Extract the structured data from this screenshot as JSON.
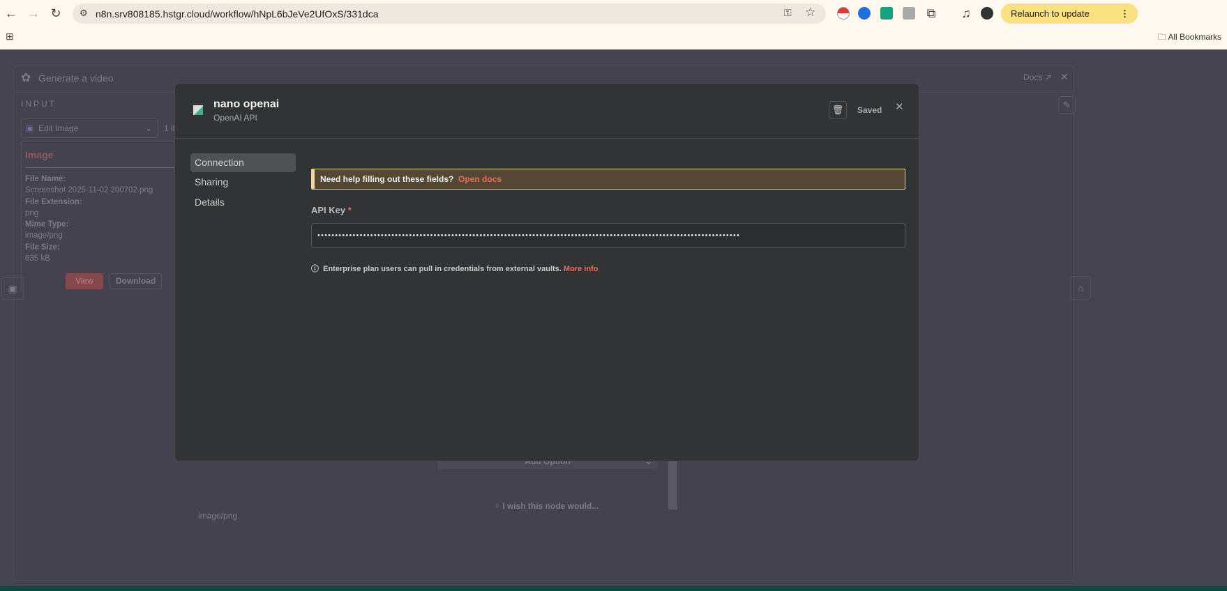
{
  "browser": {
    "url": "n8n.srv808185.hstgr.cloud/workflow/hNpL6bJeVe2UfOxS/331dca",
    "relaunch_label": "Relaunch to update",
    "bookmarks_label": "All Bookmarks"
  },
  "node_panel": {
    "title": "Generate a video",
    "docs_label": "Docs",
    "input_label": "INPUT",
    "dropdown_value": "Edit Image",
    "items_count": "1 it",
    "binary": {
      "title": "Image",
      "fields": [
        {
          "label": "File Name:",
          "value": "Screenshot 2025-11-02 200702.png"
        },
        {
          "label": "File Extension:",
          "value": "png"
        },
        {
          "label": "Mime Type:",
          "value": "image/png"
        },
        {
          "label": "File Size:",
          "value": "635 kB"
        }
      ],
      "view_label": "View",
      "download_label": "Download"
    },
    "add_option_label": "Add Option",
    "feedback_label": "I wish this node would...",
    "bottom_mime": "image/png"
  },
  "modal": {
    "title": "nano openai",
    "subtitle": "OpenAI API",
    "saved_label": "Saved",
    "menu": [
      {
        "label": "Connection"
      },
      {
        "label": "Sharing"
      },
      {
        "label": "Details"
      }
    ],
    "banner_text": "Need help filling out these fields?",
    "banner_link": "Open docs",
    "api_key_label": "API Key",
    "required_mark": "*",
    "api_key_value": "••••••••••••••••••••••••••••••••••••••••••••••••••••••••••••••••••••••••••••••••••••••••••••••••••••••••••••••••••••••••",
    "info_text": "Enterprise plan users can pull in credentials from external vaults.",
    "info_link": "More info"
  }
}
